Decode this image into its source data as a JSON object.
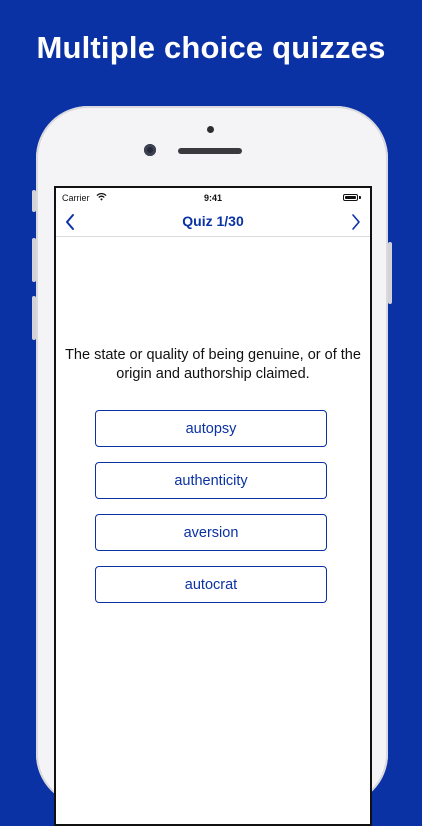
{
  "headline": "Multiple choice quizzes",
  "status_bar": {
    "carrier": "Carrier",
    "time": "9:41",
    "wifi_icon": "wifi-icon",
    "battery_icon": "battery-icon"
  },
  "nav": {
    "title": "Quiz 1/30",
    "back_icon": "chevron-left-icon",
    "next_icon": "chevron-right-icon"
  },
  "question": "The state or quality of being genuine, or of the origin and authorship claimed.",
  "answers": [
    "autopsy",
    "authenticity",
    "aversion",
    "autocrat"
  ],
  "colors": {
    "brand": "#0a32a4",
    "screen_bg": "#ffffff",
    "device_frame": "#f4f4f6"
  }
}
